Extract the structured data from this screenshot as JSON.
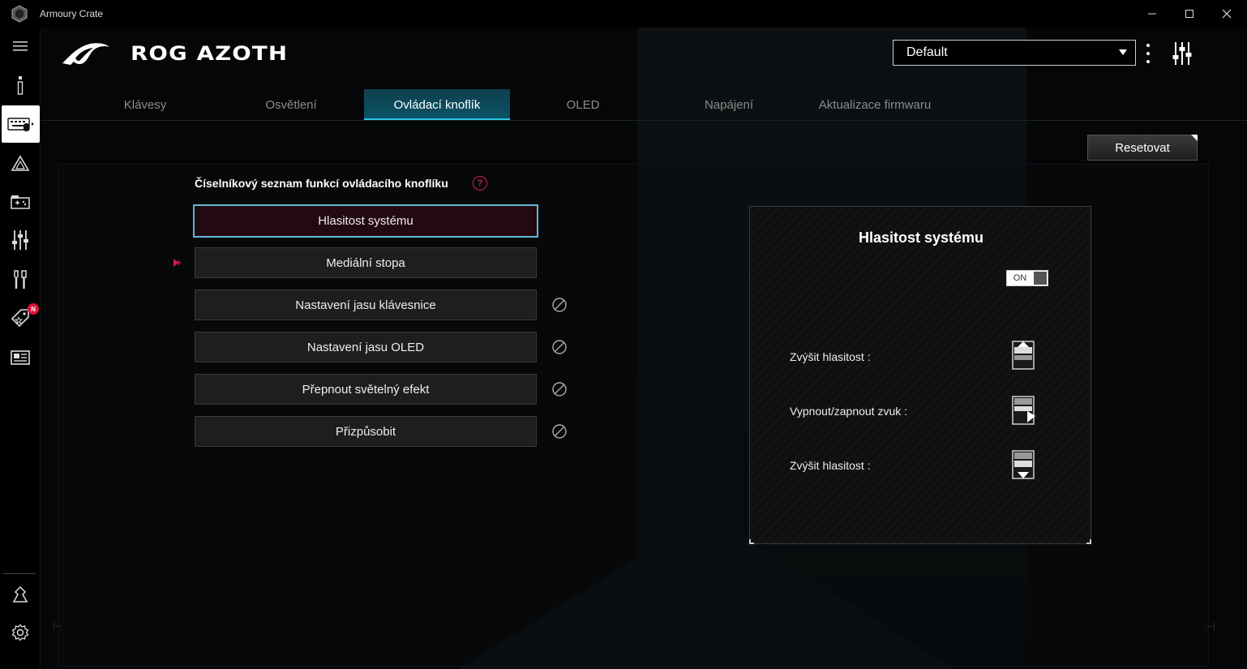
{
  "app": {
    "title": "Armoury Crate"
  },
  "window_controls": {
    "minimize": "—",
    "maximize": "☐",
    "close": "✕"
  },
  "header": {
    "product_title": "ROG AZOTH",
    "profile_value": "Default"
  },
  "sidebar": {
    "items": [
      {
        "name": "menu-icon"
      },
      {
        "name": "info-icon"
      },
      {
        "name": "keyboard-device-icon",
        "active": true
      },
      {
        "name": "aura-icon"
      },
      {
        "name": "game-library-icon"
      },
      {
        "name": "settings-sliders-icon"
      },
      {
        "name": "tools-icon"
      },
      {
        "name": "deals-tag-icon",
        "badge": "N"
      },
      {
        "name": "news-icon"
      },
      {
        "name": "user-icon"
      },
      {
        "name": "gear-icon"
      }
    ]
  },
  "tabs": [
    {
      "label": "Klávesy",
      "active": false
    },
    {
      "label": "Osvětlení",
      "active": false
    },
    {
      "label": "Ovládací knoflík",
      "active": true
    },
    {
      "label": "OLED",
      "active": false
    },
    {
      "label": "Napájení",
      "active": false
    },
    {
      "label": "Aktualizace firmwaru",
      "active": false
    }
  ],
  "reset_label": "Resetovat",
  "function_list": {
    "title": "Číselníkový seznam funkcí ovládacího knoflíku",
    "help": "?",
    "items": [
      {
        "label": "Hlasitost systému",
        "selected": true,
        "disabled_icon": false
      },
      {
        "label": "Mediální stopa",
        "selected": false,
        "disabled_icon": false
      },
      {
        "label": "Nastavení jasu klávesnice",
        "selected": false,
        "disabled_icon": true
      },
      {
        "label": "Nastavení jasu OLED",
        "selected": false,
        "disabled_icon": true
      },
      {
        "label": "Přepnout světelný efekt",
        "selected": false,
        "disabled_icon": true
      },
      {
        "label": "Přizpůsobit",
        "selected": false,
        "disabled_icon": true
      }
    ]
  },
  "detail": {
    "title": "Hlasitost systému",
    "toggle_label": "ON",
    "rows": [
      {
        "label": "Zvýšit hlasitost :",
        "icon": "knob-up-icon"
      },
      {
        "label": "Vypnout/zapnout zvuk :",
        "icon": "knob-press-icon"
      },
      {
        "label": "Zvýšit hlasitost :",
        "icon": "knob-down-icon"
      }
    ]
  },
  "colors": {
    "accent_cyan": "#2ec4e6",
    "accent_red": "#d8214a",
    "tab_active_bg": "#0b5467"
  }
}
